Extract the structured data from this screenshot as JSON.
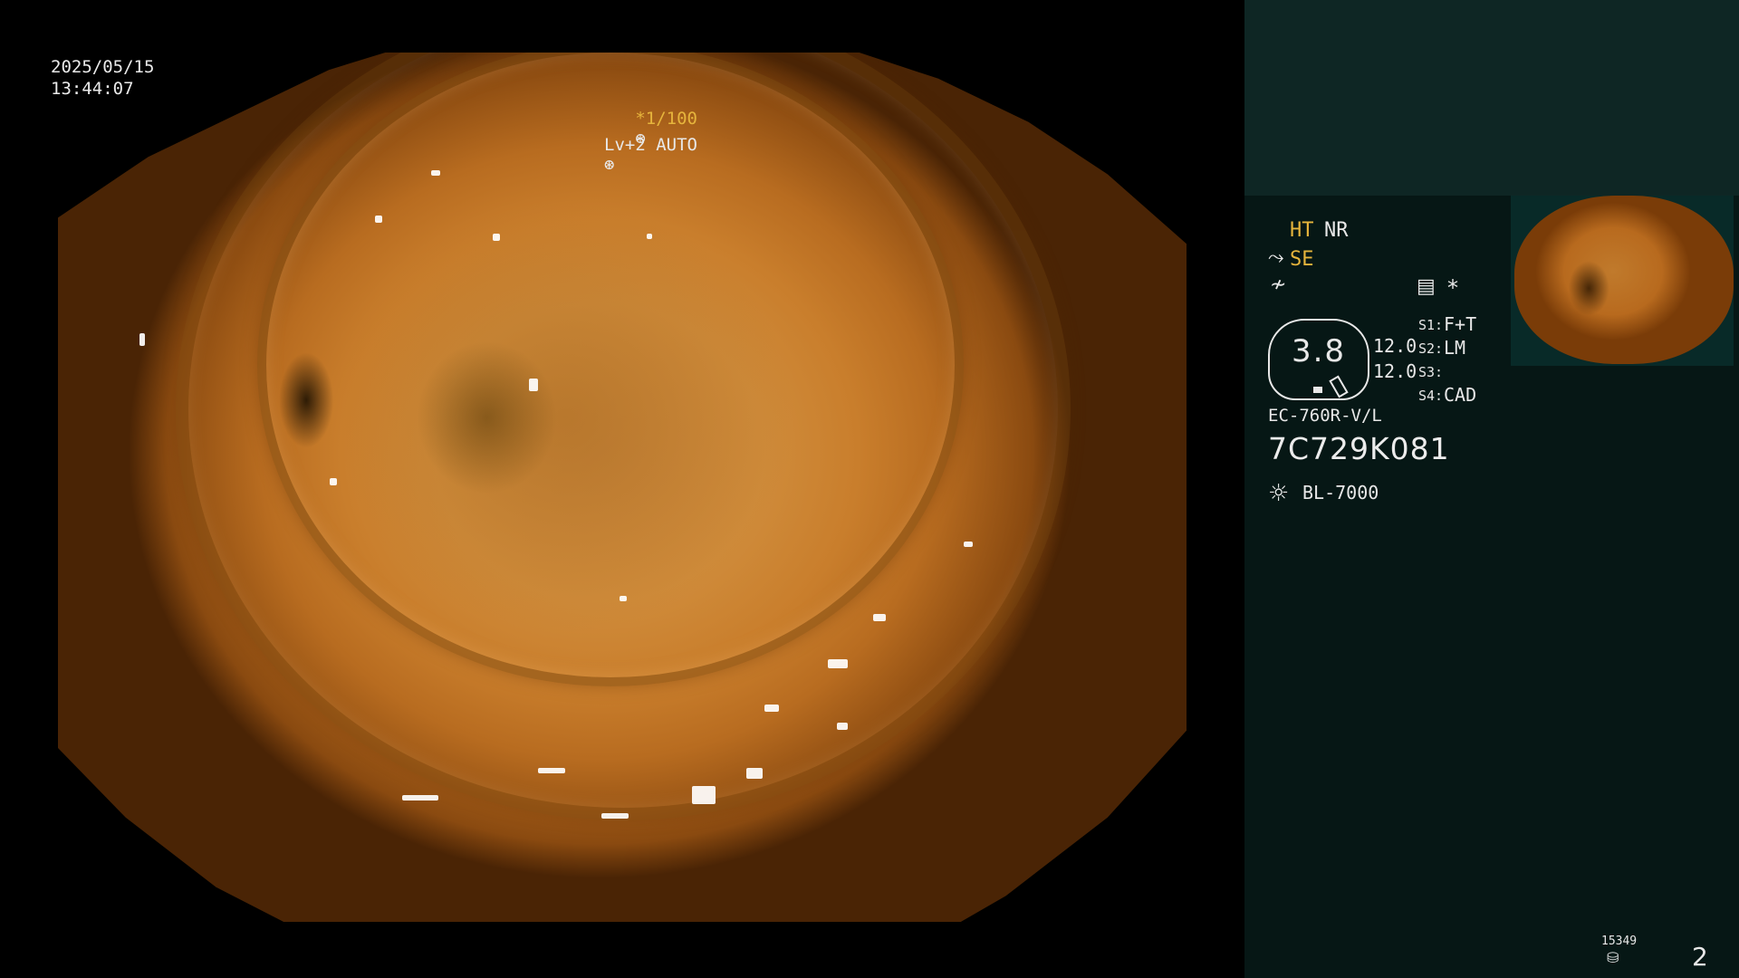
{
  "osd": {
    "date": "2025/05/15",
    "time": "13:44:07",
    "shutter": "*1/100",
    "agc": "Lv+2 AUTO"
  },
  "panel": {
    "ht_label": "HT",
    "nr_label": "NR",
    "se_label": "SE",
    "meter_value": "3.8",
    "level_top": "12.0",
    "level_bottom": "12.0",
    "switch_prefix_1": "S1:",
    "switch_value_1": "F+T",
    "switch_prefix_2": "S2:",
    "switch_value_2": "LM",
    "switch_prefix_3": "S3:",
    "switch_value_3": "",
    "switch_prefix_4": "S4:",
    "switch_value_4": "CAD",
    "model": "EC-760R-V/L",
    "serial": "7C729K081",
    "light_source": "BL-7000",
    "counter": "15349",
    "page": "2"
  },
  "colors": {
    "accent_yellow": "#e6b43c",
    "panel_bg": "#061715",
    "panel_top_bg": "#0e2624"
  },
  "icons": {
    "shutter": "aperture-icon",
    "agc": "brightness-icon",
    "structure": "wave-arrow-icon",
    "color": "slash-icon",
    "image_mode": "image-mode-icon",
    "asterisk": "asterisk-icon",
    "light": "sun-icon",
    "storage": "storage-icon"
  }
}
